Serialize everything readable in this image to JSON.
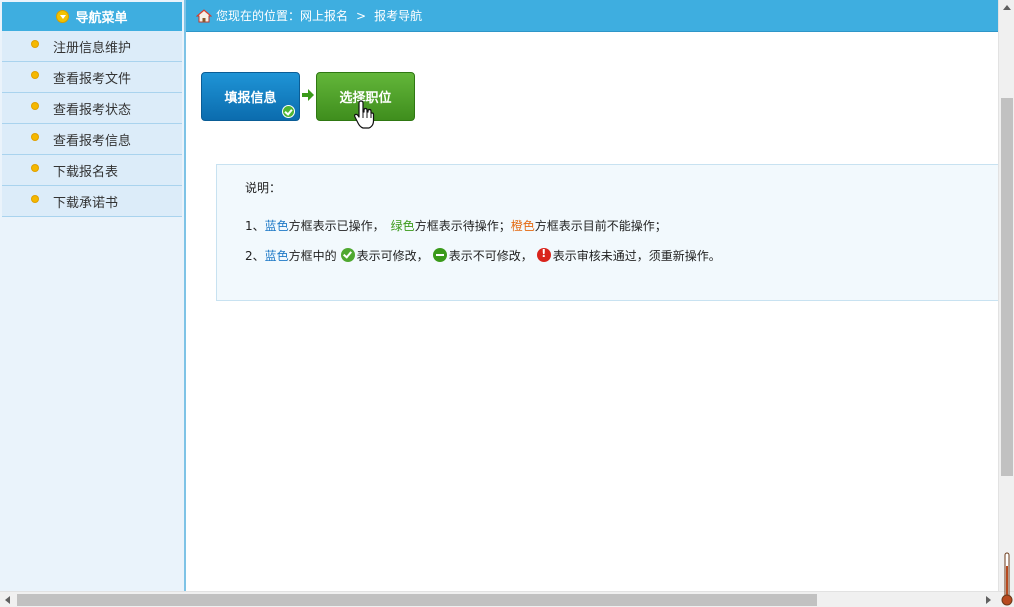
{
  "sidebar": {
    "title": "导航菜单",
    "items": [
      {
        "label": "注册信息维护"
      },
      {
        "label": "查看报考文件"
      },
      {
        "label": "查看报考状态"
      },
      {
        "label": "查看报考信息"
      },
      {
        "label": "下载报名表"
      },
      {
        "label": "下载承诺书"
      }
    ]
  },
  "breadcrumb": {
    "prefix": "您现在的位置：",
    "items": [
      "网上报名",
      "报考导航"
    ],
    "separator": ">"
  },
  "steps": [
    {
      "label": "填报信息",
      "status": "completed",
      "color": "#0b6cae"
    },
    {
      "label": "选择职位",
      "status": "pending",
      "color": "#3f8e1d"
    }
  ],
  "notice": {
    "title": "说明：",
    "line1": {
      "prefix": "1、",
      "blue": "蓝色",
      "blue_text": "方框表示已操作，",
      "green": "绿色",
      "green_text": "方框表示待操作；",
      "orange": "橙色",
      "orange_text": "方框表示目前不能操作；"
    },
    "line2": {
      "prefix": "2、",
      "blue": "蓝色",
      "text_a": "方框中的",
      "text_b": "表示可修改，",
      "text_c": "表示不可修改，",
      "text_d": "表示审核未通过，须重新操作。"
    }
  },
  "colors": {
    "header_blue": "#3eaee0",
    "blue": "#1f7ac7",
    "green": "#3a9a1a",
    "orange": "#e46a12"
  }
}
